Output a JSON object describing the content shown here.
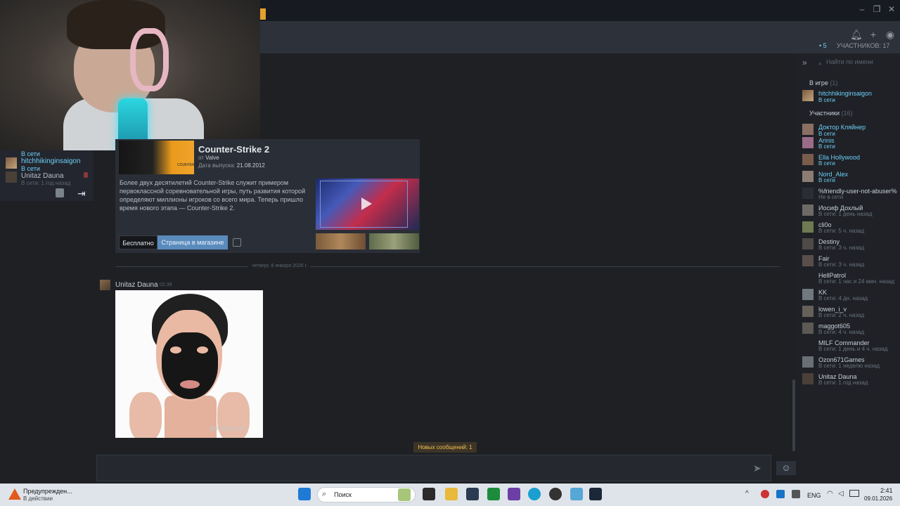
{
  "window": {
    "min_icon": "minimize-icon",
    "max_icon": "maximize-icon",
    "close_icon": "close-icon"
  },
  "header": {
    "online_dot": "•",
    "online_count": "5",
    "participants_label": "УЧАСТНИКОВ: 17",
    "icons": [
      "bell-icon",
      "add-friend-icon",
      "voice-chat-icon"
    ]
  },
  "left_panel": {
    "items": [
      {
        "name": "",
        "status": "В сети"
      },
      {
        "name": "hitchhikinginsaigon",
        "status": "В сети"
      },
      {
        "name": "Unitaz Dauna",
        "status": "В сети: 1 год назад"
      }
    ]
  },
  "card": {
    "title": "Counter-Strike 2",
    "developer_prefix": "от",
    "developer": "Valve",
    "release_label": "Дата выпуска:",
    "release_date": "21.08.2012",
    "cover_text": "COUNTER STRIKE",
    "description": "Более двух десятилетий Counter-Strike служит примером первоклассной соревновательной игры, путь развития которой определяют миллионы игроков со всего мира. Теперь пришло время нового этапа — Counter-Strike 2.",
    "free_label": "Бесплатно",
    "store_label": "Страница в магазине"
  },
  "chat": {
    "date_divider": "четверг, 8 января 2026 г.",
    "sender": "Unitaz Dauna",
    "time": "02:39",
    "photo_watermark": "BelOptovik",
    "new_messages": "Новых сообщений: 1"
  },
  "members": {
    "search_placeholder": "Найти по имени",
    "ingame_label": "В игре",
    "ingame_count": "(1)",
    "ingame": [
      {
        "name": "hitchhikinginsaigon",
        "status": "В сети"
      }
    ],
    "members_label": "Участники",
    "members_count": "(16)",
    "list": [
      {
        "name": "Доктор Кляйнер",
        "status": "В сети",
        "online": true
      },
      {
        "name": "Arinis",
        "status": "В сети",
        "online": true
      },
      {
        "name": "Ella Hollywood",
        "status": "В сети",
        "online": true
      },
      {
        "name": "Nord_Alex",
        "status": "В сети",
        "online": true
      },
      {
        "name": "%friendly-user-not-abuser%",
        "status": "Не в сети",
        "online": false
      },
      {
        "name": "Иосиф Дохлый",
        "status": "В сети: 1 день назад",
        "online": false
      },
      {
        "name": "cli0o",
        "status": "В сети: 5 ч. назад",
        "online": false
      },
      {
        "name": "Destiny",
        "status": "В сети: 3 ч. назад",
        "online": false
      },
      {
        "name": "Fair",
        "status": "В сети: 3 ч. назад",
        "online": false
      },
      {
        "name": "HellPatrol",
        "status": "В сети: 1 час и 24 мин. назад",
        "online": false
      },
      {
        "name": "KK",
        "status": "В сети: 4 дн. назад",
        "online": false
      },
      {
        "name": "lowen_i_v",
        "status": "В сети: 2 ч. назад",
        "online": false
      },
      {
        "name": "maggot605",
        "status": "В сети: 4 ч. назад",
        "online": false
      },
      {
        "name": "MILF Commander",
        "status": "В сети: 1 день и 4 ч. назад",
        "online": false
      },
      {
        "name": "Ozon671Games",
        "status": "В сети: 1 неделю назад",
        "online": false
      },
      {
        "name": "Unitaz Dauna",
        "status": "В сети: 1 год назад",
        "online": false
      }
    ]
  },
  "taskbar": {
    "warning_title": "Предупрежден...",
    "warning_sub": "В действии",
    "search_placeholder": "Поиск",
    "lang": "ENG",
    "time": "2:41",
    "date": "09.01.2026"
  },
  "colors": {
    "online": "#6dcff6",
    "accent_green": "#3a9c42",
    "store_button": "#5a8bbd",
    "new_messages": "#f2c14e"
  }
}
